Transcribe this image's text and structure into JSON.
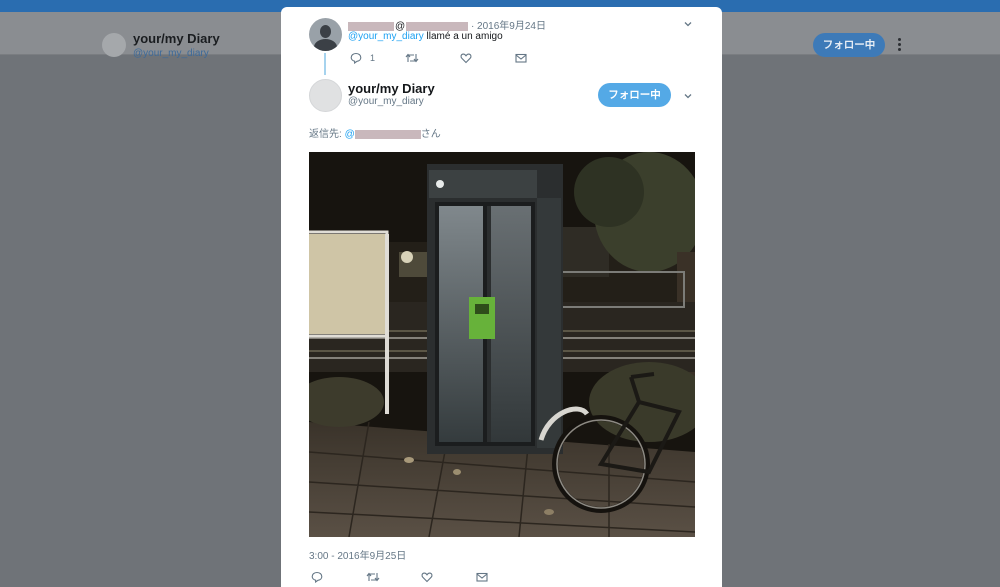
{
  "background_profile": {
    "name": "your/my Diary",
    "handle": "@your_my_diary",
    "follow_label": "フォロー中"
  },
  "original_tweet": {
    "at_sign": "@",
    "date": "· 2016年9月24日",
    "mention": "@your_my_diary",
    "text": " llamé a un amigo",
    "reply_count": "1"
  },
  "tweet": {
    "name": "your/my Diary",
    "handle": "@your_my_diary",
    "follow_label": "フォロー中",
    "reply_prefix": "返信先: ",
    "reply_mention_at": "@",
    "reply_suffix": "さん",
    "timestamp": "3:00 - 2016年9月25日"
  },
  "colors": {
    "accent": "#1da1f2",
    "follow_button": "#54a9e6",
    "thread_line": "#a6d3ee"
  },
  "icons": [
    "reply-icon",
    "retweet-icon",
    "like-icon",
    "dm-icon",
    "chevron-down-icon",
    "more-icon"
  ]
}
